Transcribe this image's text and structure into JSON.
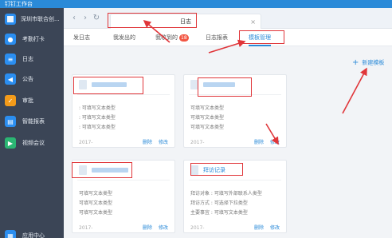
{
  "window": {
    "title": "钉钉工作台"
  },
  "sidebar": {
    "org_name": "深圳市联合创...",
    "items": [
      {
        "label": "考勤打卡",
        "icon": "location-pin-icon",
        "color": "#2b8ef0"
      },
      {
        "label": "日志",
        "icon": "log-icon",
        "color": "#2b8ef0"
      },
      {
        "label": "公告",
        "icon": "megaphone-icon",
        "color": "#2b8ef0"
      },
      {
        "label": "审批",
        "icon": "approval-icon",
        "color": "#f39b1a"
      },
      {
        "label": "智能报表",
        "icon": "report-icon",
        "color": "#2b8ef0"
      },
      {
        "label": "视频会议",
        "icon": "video-icon",
        "color": "#2bb673"
      },
      {
        "label": "应用中心",
        "icon": "app-center-icon",
        "color": "#2b8ef0"
      }
    ]
  },
  "toolbar": {
    "tab_label": "日志",
    "close_symbol": "×"
  },
  "subnav": {
    "tabs": [
      {
        "label": "发日志"
      },
      {
        "label": "我发出的"
      },
      {
        "label": "我收到的",
        "badge": "18"
      },
      {
        "label": "日志报表"
      },
      {
        "label": "模板管理",
        "active": true
      }
    ]
  },
  "actions": {
    "new_template": "新建模板"
  },
  "cards": [
    {
      "name": "",
      "rows": [
        ": 可填写文本类型",
        ": 可填写文本类型",
        ": 可填写文本类型"
      ],
      "meta": "2017-",
      "delete": "删除",
      "edit": "修改"
    },
    {
      "name": "",
      "rows": [
        "可填写文本类型",
        "可填写文本类型",
        "可填写文本类型"
      ],
      "meta": "2017-",
      "delete": "删除",
      "edit": "修改"
    },
    {
      "name": "",
      "rows": [
        "可填写文本类型",
        "可填写文本类型",
        "可填写文本类型"
      ],
      "meta": "2017-",
      "delete": "删除",
      "edit": "修改"
    },
    {
      "name": "拜访记录",
      "rows": [
        "拜访对象 : 可填写外部联系人类型",
        "拜访方式 : 可选择下拉类型",
        "主要事宜 : 可填写文本类型"
      ],
      "meta": "2017-",
      "delete": "删除",
      "edit": "修改"
    }
  ],
  "colors": {
    "accent": "#2a8ad8",
    "annotation": "#e0363a",
    "sidebar_bg": "#3b4556"
  }
}
